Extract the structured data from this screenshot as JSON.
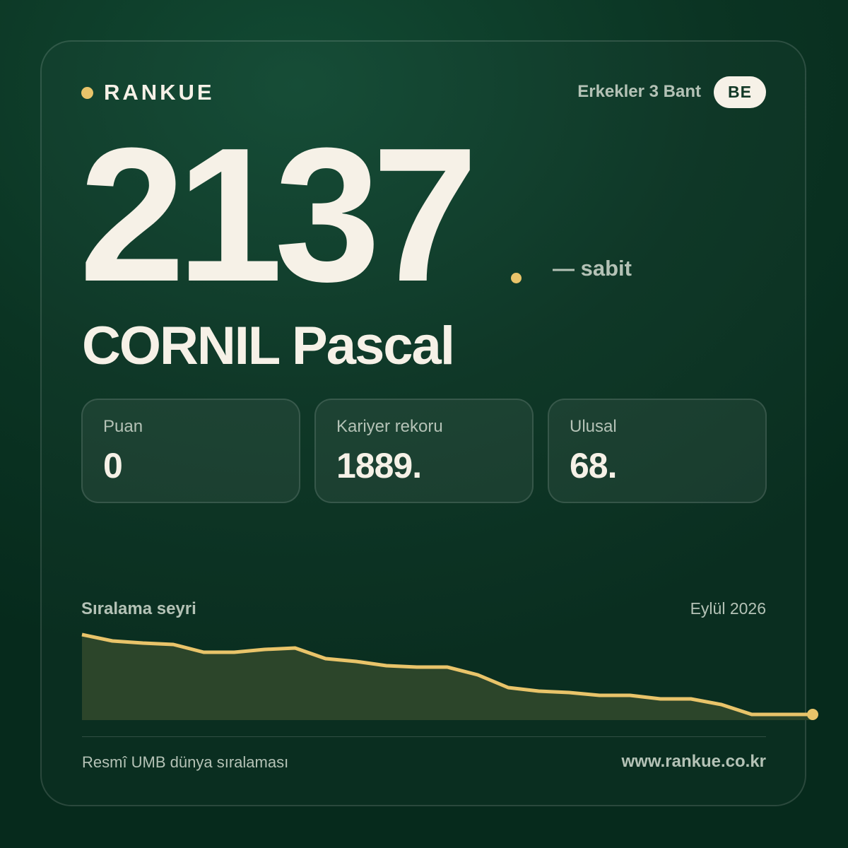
{
  "brand": {
    "name": "RANKUE",
    "dot_color": "#e9c46a"
  },
  "header": {
    "category": "Erkekler 3 Bant",
    "country_code": "BE"
  },
  "rating": {
    "value": "2137",
    "trend": "— sabit"
  },
  "player": {
    "name": "CORNIL Pascal"
  },
  "stats": [
    {
      "label": "Puan",
      "value": "0"
    },
    {
      "label": "Kariyer rekoru",
      "value": "1889."
    },
    {
      "label": "Ulusal",
      "value": "68."
    }
  ],
  "history": {
    "title": "Sıralama seyri",
    "date": "Eylül 2026"
  },
  "footer": {
    "left": "Resmî UMB dünya sıralaması",
    "right": "www.rankue.co.kr"
  },
  "colors": {
    "accent": "#e9c46a",
    "text": "#f6f1e7",
    "muted": "#b4c2b6",
    "area_fill": "#2c452a"
  },
  "chart_data": {
    "type": "area",
    "title": "Sıralama seyri",
    "x_end_label": "Eylül 2026",
    "series": [
      {
        "values": [
          898,
          907,
          910,
          912,
          923,
          923,
          919,
          917,
          932,
          936,
          942,
          944,
          944,
          955,
          973,
          978,
          980,
          984,
          984,
          989,
          989,
          997,
          1011,
          1011,
          1011
        ]
      }
    ],
    "ylim": [
      898,
      1019
    ],
    "inverted_y": true,
    "grid": false,
    "legend": "none"
  }
}
